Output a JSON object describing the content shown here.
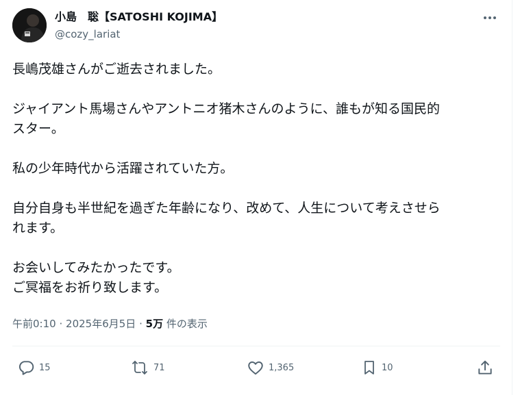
{
  "author": {
    "display_name": "小島　聡【SATOSHI KOJIMA】",
    "handle": "@cozy_lariat"
  },
  "tweet": {
    "paragraphs": [
      [
        "長嶋茂雄さんがご逝去されました。"
      ],
      [
        "ジャイアント馬場さんやアントニオ猪木さんのように、誰もが知る国民的",
        "スター。"
      ],
      [
        "私の少年時代から活躍されていた方。"
      ],
      [
        "自分自身も半世紀を過ぎた年齢になり、改めて、人生について考えさせら",
        "れます。"
      ],
      [
        "お会いしてみたかったです。",
        "ご冥福をお祈り致します。"
      ]
    ]
  },
  "meta": {
    "time": "午前0:10",
    "separator": "·",
    "date": "2025年6月5日",
    "views_count": "5万",
    "views_label": "件の表示"
  },
  "actions": {
    "replies": "15",
    "reposts": "71",
    "likes": "1,365",
    "bookmarks": "10"
  },
  "colors": {
    "text": "#0f1419",
    "secondary": "#536471",
    "border": "#eff3f4"
  },
  "icons": [
    "more-icon",
    "reply-icon",
    "repost-icon",
    "like-icon",
    "bookmark-icon",
    "share-icon"
  ]
}
